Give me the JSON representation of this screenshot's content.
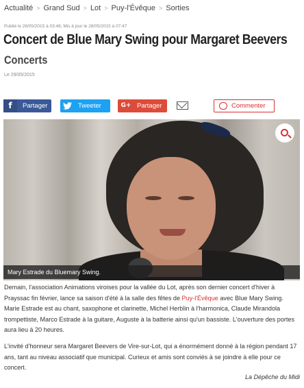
{
  "breadcrumb": [
    "Actualité",
    "Grand Sud",
    "Lot",
    "Puy-l'Évêque",
    "Sorties"
  ],
  "published": "Publié le 28/05/2015 à 03:48, Mis à jour le 28/05/2015 à 07:47",
  "title": "Concert de Blue Mary Swing pour Margaret Beevers",
  "subtitle": "Concerts",
  "date": "Le 29/05/2015",
  "share": {
    "facebook": "Partager",
    "twitter": "Tweeter",
    "googleplus": "Partager",
    "googleplus_icon": "G+",
    "comment": "Commenter"
  },
  "photo": {
    "caption": "Mary Estrade du Bluemary Swing."
  },
  "article": {
    "p1_before": "Demain, l'association Animations viroises pour la vallée du Lot, après son dernier concert d'hiver à Prayssac fin février, lance sa saison d'été à la salle des fêtes de ",
    "p1_link": "Puy-l'Évêque",
    "p1_after": " avec Blue Mary Swing. Marie Estrade est au chant, saxophone et clarinette, Michel Herblin à l'harmonica, Claude Mirandola trompettiste, Marco Estrade à la guitare, Auguste à la batterie ainsi qu'un bassiste. L'ouverture des portes aura lieu à 20 heures.",
    "p2": "L'invité d'honneur sera Margaret Beevers de Vire-sur-Lot, qui a énormément donné à la région pendant 17 ans, tant au niveau associatif que municipal. Curieux et amis sont conviés à se joindre à elle pour ce concert.",
    "source": "La Dépêche du Midi"
  },
  "colors": {
    "facebook": "#3b5998",
    "twitter": "#1da1f2",
    "googleplus": "#dd4b39",
    "accent": "#d93030"
  }
}
